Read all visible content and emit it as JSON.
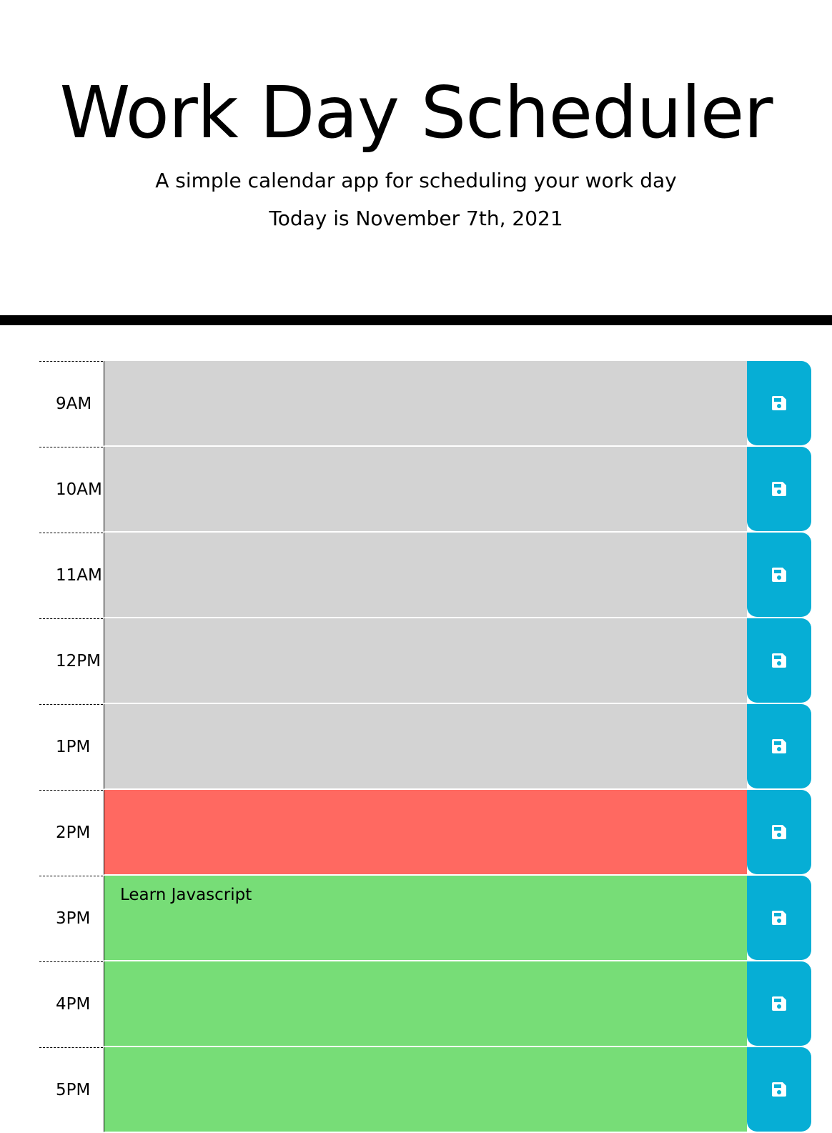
{
  "header": {
    "title": "Work Day Scheduler",
    "subtitle": "A simple calendar app for scheduling your work day",
    "today": "Today is November 7th, 2021"
  },
  "colors": {
    "past": "#d3d3d3",
    "present": "#ff6961",
    "future": "#77dd77",
    "save_button": "#06aed5"
  },
  "save_icon": "floppy-disk-icon",
  "timeblocks": [
    {
      "hour": "9AM",
      "status": "past",
      "text": ""
    },
    {
      "hour": "10AM",
      "status": "past",
      "text": ""
    },
    {
      "hour": "11AM",
      "status": "past",
      "text": ""
    },
    {
      "hour": "12PM",
      "status": "past",
      "text": ""
    },
    {
      "hour": "1PM",
      "status": "past",
      "text": ""
    },
    {
      "hour": "2PM",
      "status": "present",
      "text": ""
    },
    {
      "hour": "3PM",
      "status": "future",
      "text": "Learn Javascript"
    },
    {
      "hour": "4PM",
      "status": "future",
      "text": ""
    },
    {
      "hour": "5PM",
      "status": "future",
      "text": ""
    }
  ]
}
